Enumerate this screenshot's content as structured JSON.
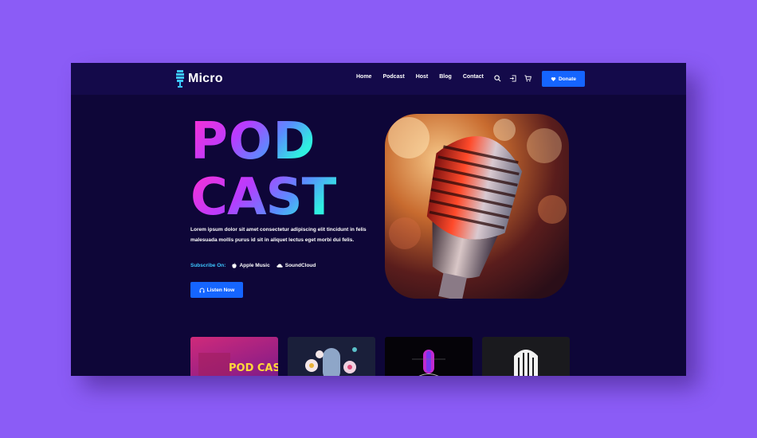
{
  "brand": {
    "name": "Micro"
  },
  "nav": {
    "items": [
      "Home",
      "Podcast",
      "Host",
      "Blog",
      "Contact"
    ],
    "icons": [
      "search-icon",
      "login-icon",
      "cart-icon"
    ],
    "donate_label": "Donate"
  },
  "hero": {
    "title_line1": "POD",
    "title_line2": "CAST",
    "description": "Lorem ipsum dolor sit amet consectetur adipiscing elit tincidunt in felis malesuada mollis purus id sit in aliquet lectus eget morbi dui felis.",
    "subscribe_label": "Subscribe On:",
    "platforms": [
      "Apple Music",
      "SoundCloud"
    ],
    "listen_label": "Listen Now"
  },
  "cards": [
    {
      "label": "POD CAST"
    },
    {
      "label": ""
    },
    {
      "label": ""
    },
    {
      "label": ""
    }
  ],
  "colors": {
    "background": "#8b5cf6",
    "frame": "#0e0638",
    "nav": "#140a4a",
    "accent": "#1565ff",
    "subscribe": "#3cc6ff",
    "gradient_start": "#ff2fd0",
    "gradient_end": "#2ff0e0"
  }
}
